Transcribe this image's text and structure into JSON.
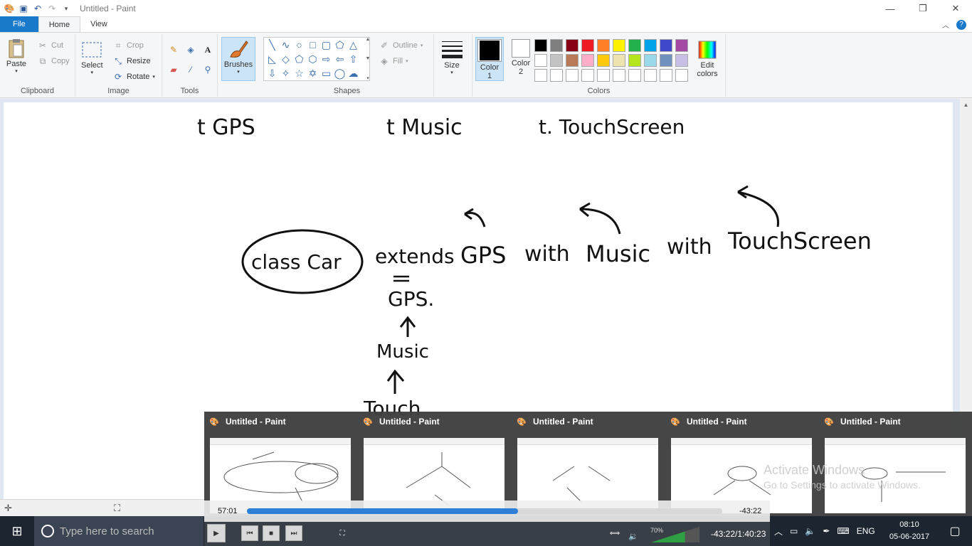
{
  "window": {
    "title": "Untitled - Paint",
    "controls": {
      "minimize": "—",
      "maximize": "❐",
      "close": "✕"
    }
  },
  "tabs": {
    "file": "File",
    "home": "Home",
    "view": "View"
  },
  "ribbon": {
    "clipboard": {
      "label": "Clipboard",
      "paste": "Paste",
      "cut": "Cut",
      "copy": "Copy"
    },
    "image": {
      "label": "Image",
      "select": "Select",
      "crop": "Crop",
      "resize": "Resize",
      "rotate": "Rotate"
    },
    "tools": {
      "label": "Tools"
    },
    "brushes": {
      "label": "Brushes"
    },
    "shapes": {
      "label": "Shapes",
      "outline": "Outline",
      "fill": "Fill"
    },
    "size": {
      "label": "Size"
    },
    "colors": {
      "label": "Colors",
      "color1": "Color 1",
      "color2": "Color 2",
      "edit": "Edit colors",
      "color1_value": "#000000",
      "color2_value": "#ffffff",
      "palette_row1": [
        "#000000",
        "#7f7f7f",
        "#880015",
        "#ed1c24",
        "#ff7f27",
        "#fff200",
        "#22b14c",
        "#00a2e8",
        "#3f48cc",
        "#a349a4"
      ],
      "palette_row2": [
        "#ffffff",
        "#c3c3c3",
        "#b97a57",
        "#ffaec9",
        "#ffc90e",
        "#efe4b0",
        "#b5e61d",
        "#99d9ea",
        "#7092be",
        "#c8bfe7"
      ],
      "palette_row3": [
        "#ffffff",
        "#ffffff",
        "#ffffff",
        "#ffffff",
        "#ffffff",
        "#ffffff",
        "#ffffff",
        "#ffffff",
        "#ffffff",
        "#ffffff"
      ]
    }
  },
  "canvas": {
    "line1": [
      "t GPS",
      "t Music",
      "t. TouchScreen"
    ],
    "class_label": "class Car",
    "extends": "extends",
    "gps": "GPS",
    "with1": "with",
    "music": "Music",
    "with2": "with",
    "touchscreen": "TouchScreen",
    "gps_down": "GPS.",
    "music_down": "Music",
    "touch_down": "Touch"
  },
  "thumbnails": [
    {
      "title": "Untitled - Paint"
    },
    {
      "title": "Untitled - Paint"
    },
    {
      "title": "Untitled - Paint"
    },
    {
      "title": "Untitled - Paint"
    },
    {
      "title": "Untitled - Paint"
    }
  ],
  "activation": {
    "line1": "Activate Windows",
    "line2": "Go to Settings to activate Windows."
  },
  "media": {
    "elapsed": "57:01",
    "remaining": "-43:22",
    "progress": 0.57,
    "volume_label": "70%",
    "volume": 0.7,
    "total": "-43:22/1:40:23"
  },
  "taskbar": {
    "search_placeholder": "Type here to search",
    "language": "ENG",
    "time": "08:10",
    "date": "05-06-2017"
  }
}
